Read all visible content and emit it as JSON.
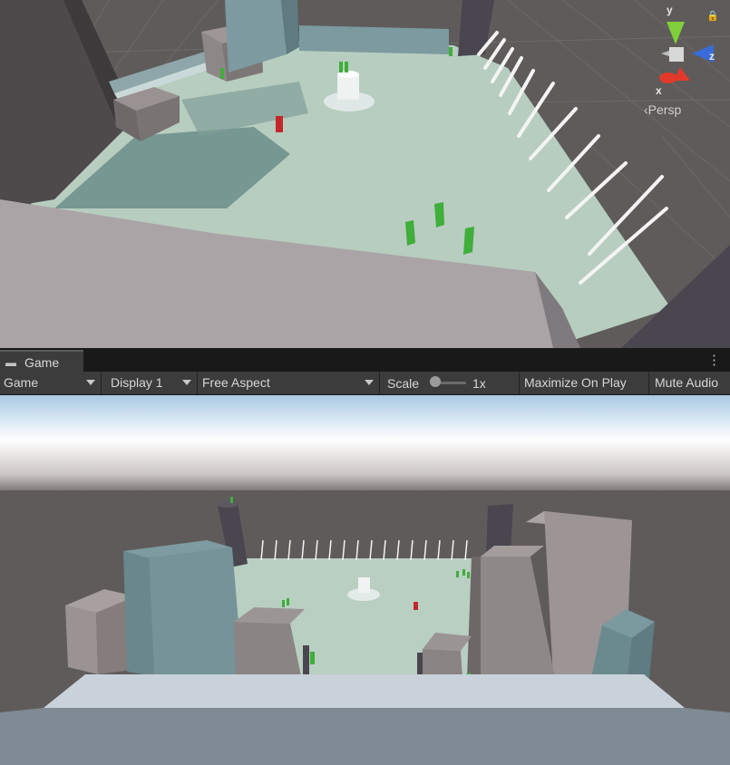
{
  "scene": {
    "gizmo": {
      "y_label": "y",
      "z_label": "z",
      "x_label": "x",
      "projection_label": "Persp",
      "lock_icon": "lock-icon"
    }
  },
  "game_panel": {
    "tab": {
      "icon": "gamepad-icon",
      "label": "Game"
    },
    "menu_icon": "kebab-menu-icon",
    "toolbar": {
      "view_mode": "Game",
      "display": "Display 1",
      "aspect": "Free Aspect",
      "scale_label": "Scale",
      "scale_value": "1x",
      "scale_slider_fraction": 0.0,
      "maximize_on_play": "Maximize On Play",
      "mute_audio": "Mute Audio"
    }
  },
  "colors": {
    "editor_dark": "#282828",
    "toolbar_bg": "#3c3c3c",
    "ground": "#b9cfc2",
    "gizmo_y": "#7fcf3a",
    "gizmo_z": "#3a6bd8",
    "gizmo_x": "#e23a2a"
  }
}
